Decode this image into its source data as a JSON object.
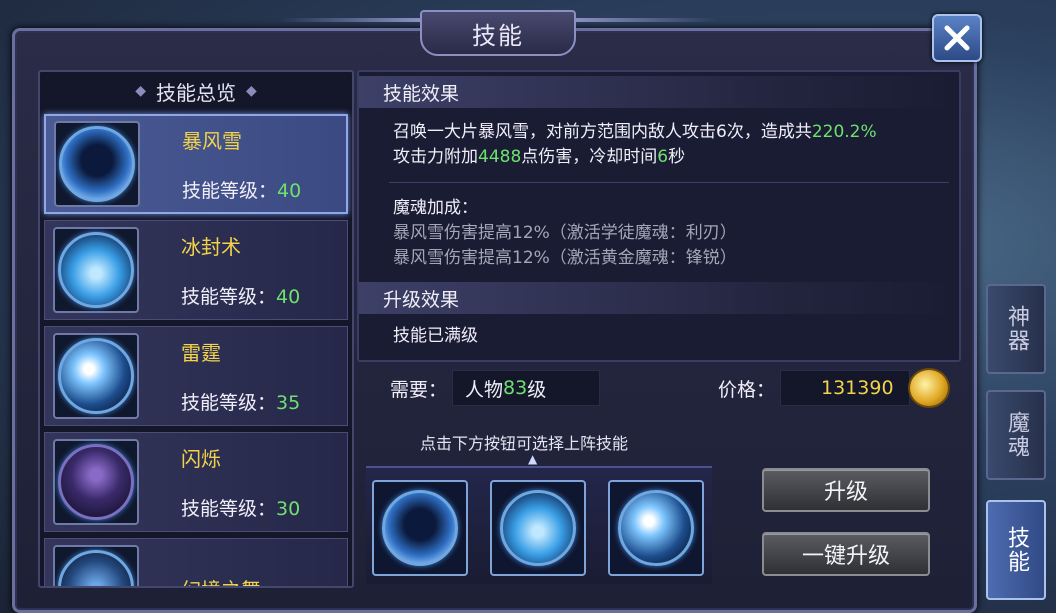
{
  "window": {
    "title": "技能",
    "close_icon": "close-x-icon"
  },
  "list": {
    "header": "技能总览",
    "items": [
      {
        "name": "暴风雪",
        "level_label": "技能等级：",
        "level": "40",
        "selected": true,
        "icon": "blizzard-icon"
      },
      {
        "name": "冰封术",
        "level_label": "技能等级：",
        "level": "40",
        "selected": false,
        "icon": "ice-crystal-icon"
      },
      {
        "name": "雷霆",
        "level_label": "技能等级：",
        "level": "35",
        "selected": false,
        "icon": "thunder-orb-icon"
      },
      {
        "name": "闪烁",
        "level_label": "技能等级：",
        "level": "30",
        "selected": false,
        "icon": "blink-figure-icon"
      },
      {
        "name": "幻境之舞",
        "level_label": "",
        "level": "",
        "selected": false,
        "icon": "illusion-dance-icon"
      }
    ]
  },
  "effect": {
    "title": "技能效果",
    "line1_a": "召唤一大片暴风雪，对前方范围内敌人攻击6次，造成共",
    "line1_b": "220.2%",
    "line2_a": "攻击力附加",
    "line2_b": "4488",
    "line2_c": "点伤害，冷却时间",
    "line2_d": "6",
    "line2_e": "秒",
    "soul_title": "魔魂加成：",
    "soul_line1": "暴风雪伤害提高12%（激活学徒魔魂：利刃）",
    "soul_line2": "暴风雪伤害提高12%（激活黄金魔魂：锋锐）"
  },
  "upgrade": {
    "title": "升级效果",
    "text": "技能已满级"
  },
  "requirement": {
    "label": "需要：",
    "prefix": "人物",
    "level": "83",
    "suffix": "级"
  },
  "price": {
    "label": "价格：",
    "value": "131390",
    "icon": "gold-coin-icon"
  },
  "slots": {
    "hint": "点击下方按钮可选择上阵技能",
    "icons": [
      "blizzard-icon",
      "ice-crystal-icon",
      "thunder-orb-icon"
    ]
  },
  "buttons": {
    "upgrade": "升级",
    "upgrade_all": "一键升级"
  },
  "side_tabs": [
    {
      "label": "神器",
      "active": false
    },
    {
      "label": "魔魂",
      "active": false
    },
    {
      "label": "技能",
      "active": true
    }
  ],
  "colors": {
    "skill_name": "#f2d34b",
    "highlight_green": "#6fe06f",
    "price_gold": "#f2d34b",
    "accent_blue": "#8fa7e6"
  }
}
